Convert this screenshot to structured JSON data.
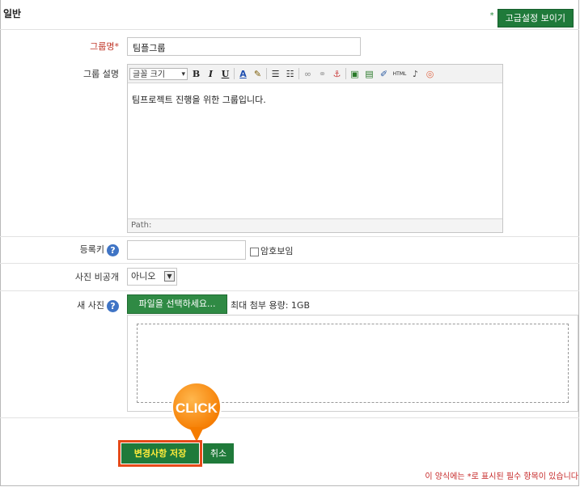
{
  "section": {
    "title": "일반"
  },
  "advanced": {
    "star": "*",
    "label": "고급설정 보이기"
  },
  "fields": {
    "group_name": {
      "label": "그룹명",
      "required_mark": "*",
      "value": "팀플그룹"
    },
    "group_desc": {
      "label": "그룹 설명",
      "font_size_select": "글꼴 크기",
      "toolbar_html": "HTML",
      "content": "팀프로젝트 진행을 위한 그룹입니다.",
      "path": "Path:"
    },
    "enroll_key": {
      "label": "등록키",
      "value": "",
      "show_password": "암호보임"
    },
    "photo_private": {
      "label": "사진 비공개",
      "value": "아니오"
    },
    "new_photo": {
      "label": "새 사진",
      "choose_button": "파일을 선택하세요...",
      "max_size": "최대 첨부 용량: 1GB"
    }
  },
  "actions": {
    "save": "변경사항 저장",
    "cancel": "취소",
    "click_badge": "CLICK"
  },
  "footer": {
    "required_note": "이 양식에는 *로 표시된 필수 항목이 있습니다"
  },
  "colors": {
    "accent_green": "#1f7a3a",
    "highlight_orange": "#e64a19",
    "help_blue": "#3f74c5",
    "required_red": "#c62828"
  }
}
